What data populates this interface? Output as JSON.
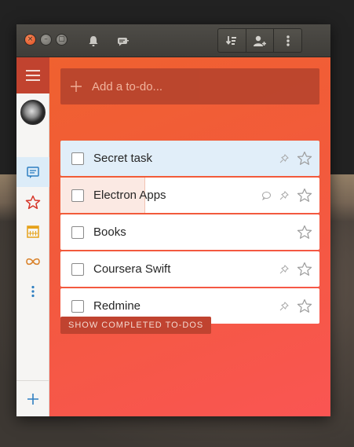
{
  "titlebar": {
    "buttons": {
      "close": "×",
      "minimize": "–",
      "maximize": "▢"
    }
  },
  "add_todo": {
    "placeholder": "Add a to-do..."
  },
  "tasks": [
    {
      "title": "Secret task",
      "selected": true,
      "has_comment": false,
      "has_pin": true
    },
    {
      "title": "Electron Apps",
      "selected": false,
      "has_comment": true,
      "has_pin": true,
      "progress": 0.33
    },
    {
      "title": "Books",
      "selected": false,
      "has_comment": false,
      "has_pin": false
    },
    {
      "title": "Coursera Swift",
      "selected": false,
      "has_comment": false,
      "has_pin": true
    },
    {
      "title": "Redmine",
      "selected": false,
      "has_comment": false,
      "has_pin": true
    }
  ],
  "show_completed_label": "SHOW COMPLETED TO-DOS",
  "colors": {
    "accent": "#c1432f",
    "background_top": "#f0612f",
    "background_bottom": "#fa5553",
    "selected_row": "#e1eef9"
  },
  "icons": {
    "sidebar": [
      "menu-icon",
      "inbox-icon",
      "star-icon",
      "calendar-icon",
      "infinity-icon",
      "more-vertical-icon",
      "plus-icon"
    ]
  }
}
